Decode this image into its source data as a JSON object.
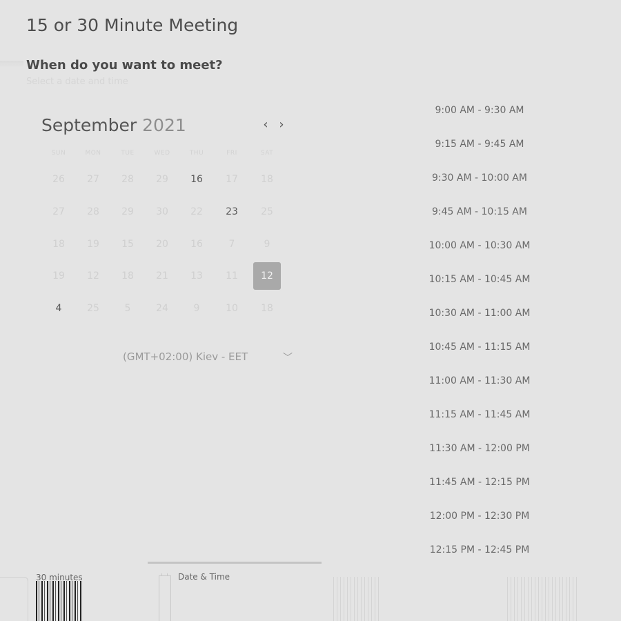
{
  "header": {
    "title": "15 or 30 Minute Meeting",
    "question": "When do you want to meet?",
    "subquestion": "Select a date and time"
  },
  "calendar": {
    "month": "September",
    "year": "2021",
    "prev_icon": "chevron-left-icon",
    "next_icon": "chevron-right-icon",
    "weekdays": [
      "SUN",
      "MON",
      "TUE",
      "WED",
      "THU",
      "FRI",
      "SAT"
    ],
    "weeks": [
      [
        "26",
        "27",
        "28",
        "29",
        "16",
        "17",
        "18"
      ],
      [
        "27",
        "28",
        "29",
        "30",
        "22",
        "23",
        "25"
      ],
      [
        "18",
        "19",
        "15",
        "20",
        "16",
        "7",
        "9"
      ],
      [
        "19",
        "12",
        "18",
        "21",
        "13",
        "11",
        "12"
      ],
      [
        "4",
        "25",
        "5",
        "24",
        "9",
        "10",
        "18"
      ]
    ],
    "available_days": [
      "16",
      "23",
      "4"
    ],
    "selected_day": "12"
  },
  "timezone": {
    "label": "(GMT+02:00) Kiev - EET",
    "icon": "chevron-down-icon"
  },
  "time_slots": [
    "9:00 AM - 9:30 AM",
    "9:15 AM - 9:45 AM",
    "9:30 AM - 10:00 AM",
    "9:45 AM - 10:15 AM",
    "10:00 AM - 10:30 AM",
    "10:15 AM - 10:45 AM",
    "10:30 AM - 11:00 AM",
    "10:45 AM - 11:15 AM",
    "11:00 AM - 11:30 AM",
    "11:15 AM - 11:45 AM",
    "11:30 AM - 12:00 PM",
    "11:45 AM - 12:15 PM",
    "12:00 PM - 12:30 PM",
    "12:15 PM - 12:45 PM"
  ],
  "footer": {
    "duration_label": "30 minutes",
    "datetime_label": "Date & Time",
    "datetime_icon": "calendar-icon"
  },
  "colors": {
    "background": "#e4e4e4",
    "selected_day_bg": "#a9a9a9",
    "text_primary": "#555555",
    "text_muted": "#d0d0d0"
  }
}
